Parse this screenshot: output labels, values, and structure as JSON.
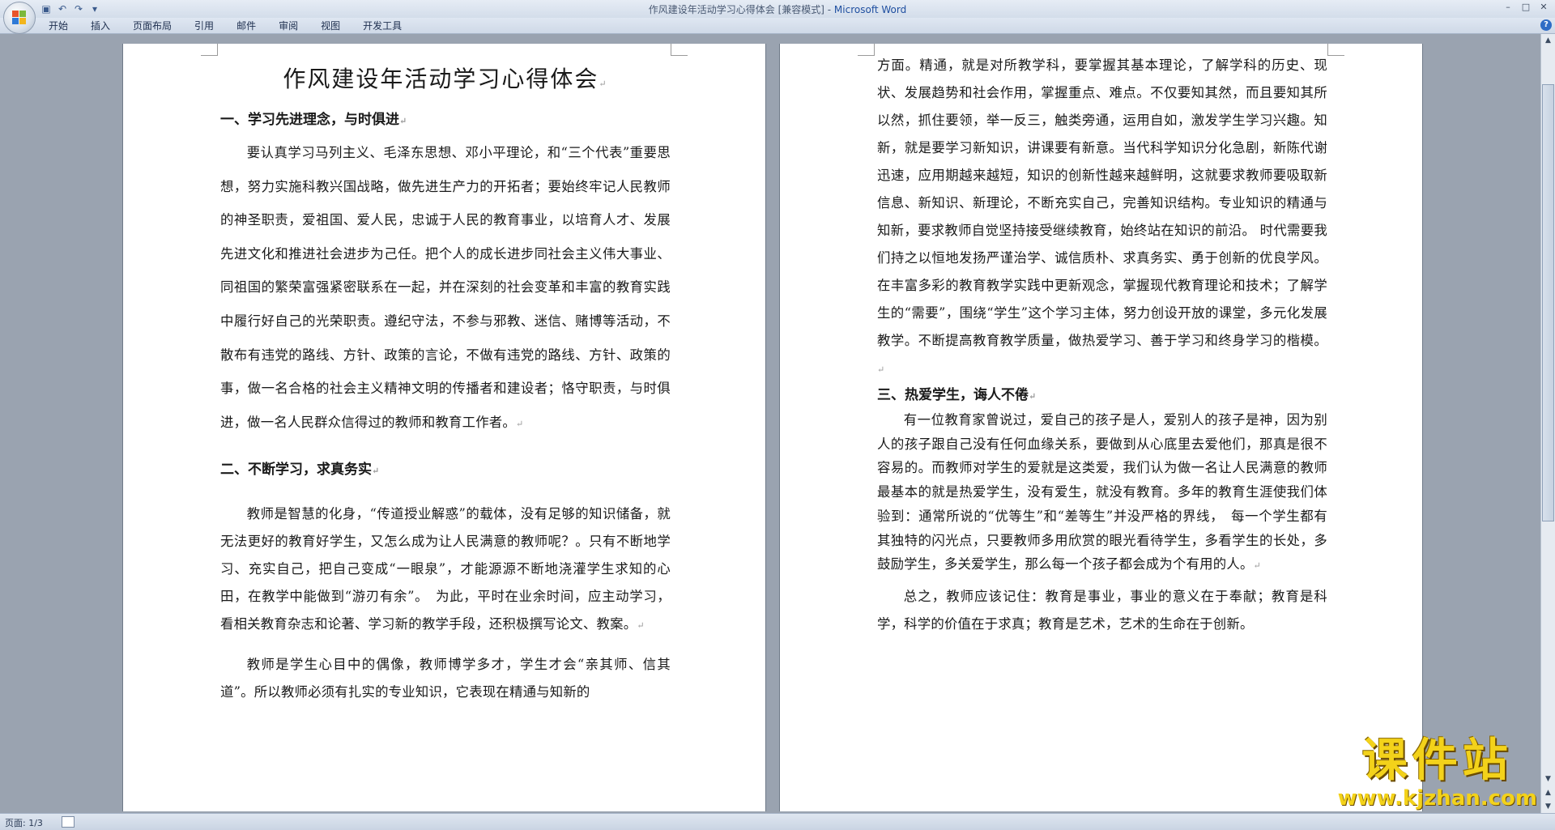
{
  "window": {
    "title": "作风建设年活动学习心得体会 [兼容模式] - ",
    "app_name": "Microsoft Word",
    "controls": [
      "–",
      "□",
      "✕"
    ]
  },
  "quick_access": [
    "save-icon",
    "undo-icon",
    "redo-icon",
    "customize-icon"
  ],
  "ribbon": {
    "tabs": [
      "开始",
      "插入",
      "页面布局",
      "引用",
      "邮件",
      "审阅",
      "视图",
      "开发工具"
    ],
    "help": "?"
  },
  "document": {
    "title": "作风建设年活动学习心得体会",
    "page1": {
      "h1": "一、学习先进理念，与时俱进",
      "p1": "要认真学习马列主义、毛泽东思想、邓小平理论，和“三个代表”重要思想，努力实施科教兴国战略，做先进生产力的开拓者；要始终牢记人民教师的神圣职责，爱祖国、爱人民，忠诚于人民的教育事业，以培育人才、发展先进文化和推进社会进步为己任。把个人的成长进步同社会主义伟大事业、同祖国的繁荣富强紧密联系在一起，并在深刻的社会变革和丰富的教育实践中履行好自己的光荣职责。遵纪守法，不参与邪教、迷信、赌博等活动，不散布有违党的路线、方针、政策的言论，不做有违党的路线、方针、政策的事，做一名合格的社会主义精神文明的传播者和建设者；恪守职责，与时俱进，做一名人民群众信得过的教师和教育工作者。",
      "h2": "二、不断学习，求真务实",
      "p2": "教师是智慧的化身，“传道授业解惑”的载体，没有足够的知识储备，就无法更好的教育好学生，又怎么成为让人民满意的教师呢？。只有不断地学习、充实自己，把自己变成“一眼泉”，才能源源不断地浇灌学生求知的心田，在教学中能做到“游刃有余”。　为此，平时在业余时间，应主动学习，看相关教育杂志和论著、学习新的教学手段，还积极撰写论文、教案。",
      "p3": "教师是学生心目中的偶像，教师博学多才，学生才会“亲其师、信其道”。所以教师必须有扎实的专业知识，它表现在精通与知新的"
    },
    "page2": {
      "p1": "方面。精通，就是对所教学科，要掌握其基本理论，了解学科的历史、现状、发展趋势和社会作用，掌握重点、难点。不仅要知其然，而且要知其所以然，抓住要领，举一反三，触类旁通，运用自如，激发学生学习兴趣。知新，就是要学习新知识，讲课要有新意。当代科学知识分化急剧，新陈代谢迅速，应用期越来越短，知识的创新性越来越鲜明，这就要求教师要吸取新信息、新知识、新理论，不断充实自己，完善知识结构。专业知识的精通与知新，要求教师自觉坚持接受继续教育，始终站在知识的前沿。 时代需要我们持之以恒地发扬严谨治学、诚信质朴、求真务实、勇于创新的优良学风。在丰富多彩的教育教学实践中更新观念，掌握现代教育理论和技术；了解学生的“需要”，围绕“学生”这个学习主体，努力创设开放的课堂，多元化发展教学。不断提高教育教学质量，做热爱学习、善于学习和终身学习的楷模。",
      "h3": "三、热爱学生，诲人不倦",
      "p2": "有一位教育家曾说过，爱自己的孩子是人，爱别人的孩子是神，因为别人的孩子跟自己没有任何血缘关系，要做到从心底里去爱他们，那真是很不容易的。而教师对学生的爱就是这类爱，我们认为做一名让人民满意的教师最基本的就是热爱学生，没有爱生，就没有教育。多年的教育生涯使我们体验到：通常所说的“优等生”和“差等生”并没严格的界线，　每一个学生都有其独特的闪光点，只要教师多用欣赏的眼光看待学生，多看学生的长处，多鼓励学生，多关爱学生，那么每一个孩子都会成为个有用的人。",
      "p3": "总之，教师应该记住：教育是事业，事业的意义在于奉献；教育是科学，科学的价值在于求真；教育是艺术，艺术的生命在于创新。"
    },
    "paragraph_mark": "↵"
  },
  "statusbar": {
    "page_info": "页面: 1/3"
  },
  "watermark": {
    "text": "课件站",
    "url": "www.kjzhan.com"
  },
  "colors": {
    "app_name": "#1f4fa0",
    "workspace": "#9aa3b0",
    "watermark": "#f3d21a"
  }
}
